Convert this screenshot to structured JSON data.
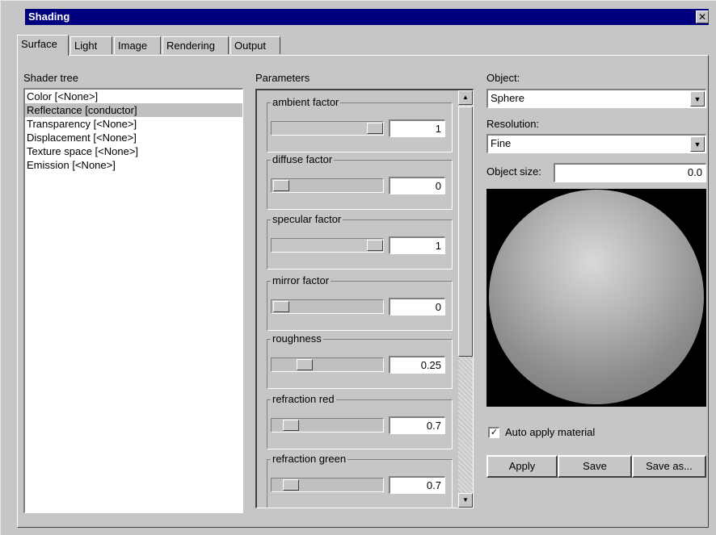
{
  "window": {
    "title": "Shading",
    "close_glyph": "✕"
  },
  "tabs": [
    {
      "label": "Surface",
      "active": true
    },
    {
      "label": "Light",
      "active": false
    },
    {
      "label": "Image",
      "active": false
    },
    {
      "label": "Rendering",
      "active": false
    },
    {
      "label": "Output",
      "active": false
    }
  ],
  "shader_list": {
    "label": "Shader tree",
    "items": [
      {
        "label": "Color [<None>]",
        "selected": false
      },
      {
        "label": "Reflectance [conductor]",
        "selected": true
      },
      {
        "label": "Transparency [<None>]",
        "selected": false
      },
      {
        "label": "Displacement [<None>]",
        "selected": false
      },
      {
        "label": "Texture space [<None>]",
        "selected": false
      },
      {
        "label": "Emission [<None>]",
        "selected": false
      }
    ]
  },
  "parameters": {
    "label": "Parameters",
    "items": [
      {
        "name": "ambient factor",
        "value": "1",
        "slider_fraction": 1.0,
        "disabled": true
      },
      {
        "name": "diffuse factor",
        "value": "0",
        "slider_fraction": 0.0,
        "disabled": false
      },
      {
        "name": "specular factor",
        "value": "1",
        "slider_fraction": 1.0,
        "disabled": true
      },
      {
        "name": "mirror factor",
        "value": "0",
        "slider_fraction": 0.0,
        "disabled": false
      },
      {
        "name": "roughness",
        "value": "0.25",
        "slider_fraction": 0.25,
        "disabled": false
      },
      {
        "name": "refraction red",
        "value": "0.7",
        "slider_fraction": 0.1,
        "disabled": false
      },
      {
        "name": "refraction green",
        "value": "0.7",
        "slider_fraction": 0.1,
        "disabled": false
      }
    ],
    "scroll_up_glyph": "▲",
    "scroll_down_glyph": "▼"
  },
  "object": {
    "label": "Object:",
    "value": "Sphere",
    "resolution_label": "Resolution:",
    "resolution_value": "Fine",
    "size_label": "Object size:",
    "size_value": "0.0",
    "arrow_glyph": "▼"
  },
  "preview": {
    "background_color": "#000000",
    "sphere_color": "#b0b0b0"
  },
  "auto_apply": {
    "label": "Auto apply material",
    "checked": true,
    "check_glyph": "✓"
  },
  "buttons": {
    "apply": "Apply",
    "save": "Save",
    "save_as": "Save as..."
  }
}
